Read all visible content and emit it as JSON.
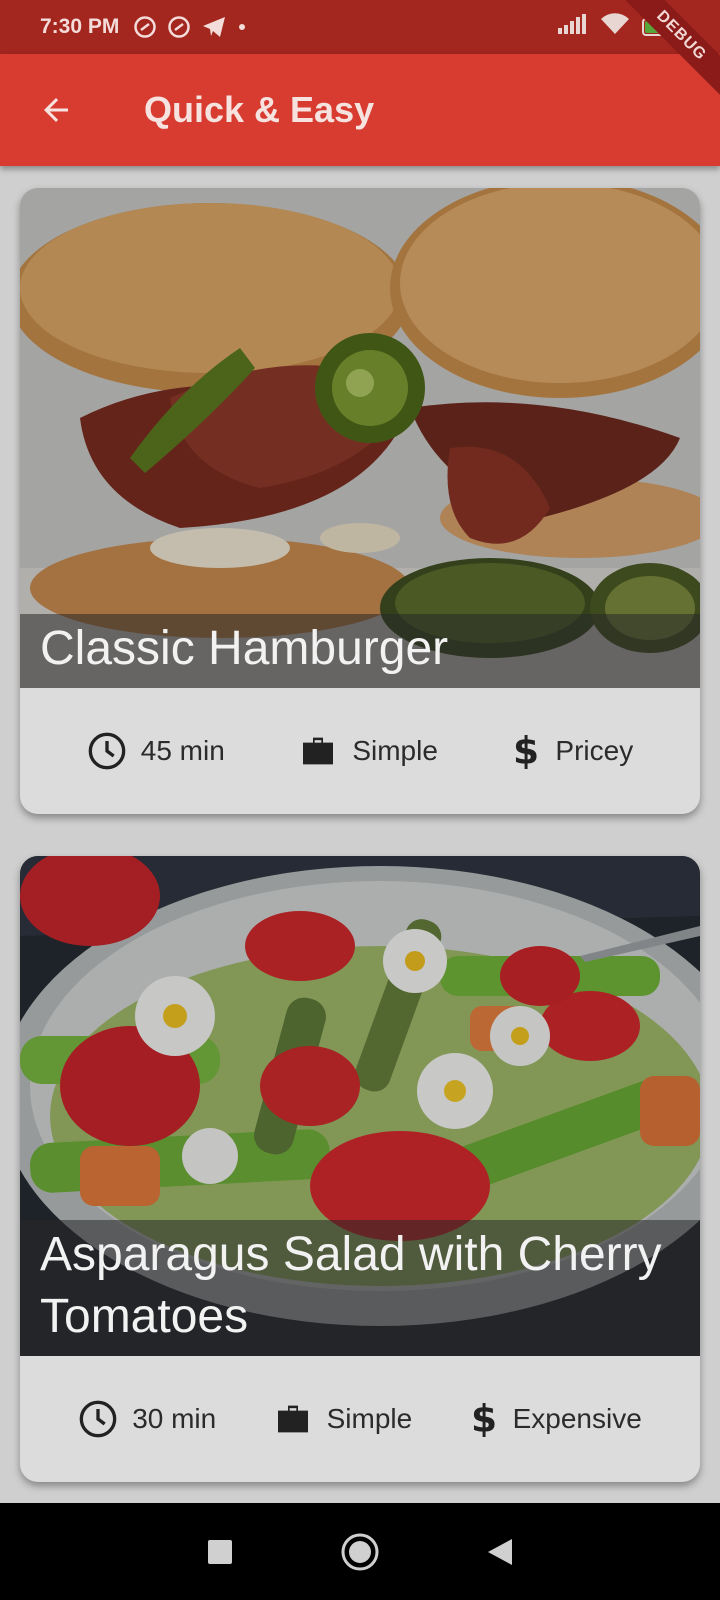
{
  "status_bar": {
    "time": "7:30 PM",
    "battery": "91",
    "debug_label": "DEBUG"
  },
  "app_bar": {
    "title": "Quick & Easy",
    "back_icon": "arrow-back-icon"
  },
  "meals": [
    {
      "title": "Classic Hamburger",
      "duration": "45 min",
      "complexity": "Simple",
      "affordability": "Pricey"
    },
    {
      "title": "Asparagus Salad with Cherry Tomatoes",
      "duration": "30 min",
      "complexity": "Simple",
      "affordability": "Expensive"
    }
  ],
  "colors": {
    "app_bar": "#d83c31",
    "status_bar": "#a3261f",
    "card": "#dcdcdc"
  }
}
